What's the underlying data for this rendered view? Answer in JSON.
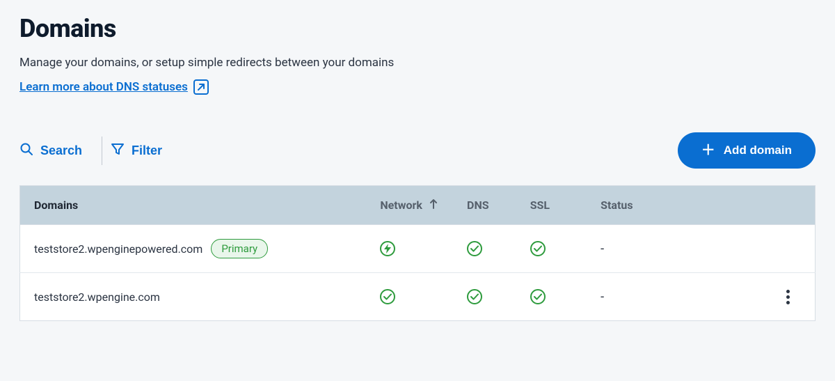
{
  "header": {
    "title": "Domains",
    "subtitle": "Manage your domains, or setup simple redirects between your domains",
    "learn_link": "Learn more about DNS statuses"
  },
  "toolbar": {
    "search_label": "Search",
    "filter_label": "Filter",
    "add_label": "Add domain"
  },
  "table": {
    "columns": {
      "domains": "Domains",
      "network": "Network",
      "dns": "DNS",
      "ssl": "SSL",
      "status": "Status"
    },
    "sort": {
      "column": "network",
      "dir": "asc"
    },
    "rows": [
      {
        "domain": "teststore2.wpenginepowered.com",
        "badge": "Primary",
        "network": "bolt-ok",
        "dns": "ok",
        "ssl": "ok",
        "status": "-",
        "menu": false
      },
      {
        "domain": "teststore2.wpengine.com",
        "badge": null,
        "network": "ok",
        "dns": "ok",
        "ssl": "ok",
        "status": "-",
        "menu": true
      }
    ]
  },
  "colors": {
    "accent": "#0a6ed1",
    "success": "#2e9b3d"
  }
}
